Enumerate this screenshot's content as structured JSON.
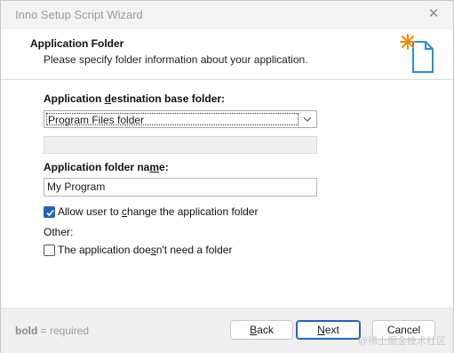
{
  "window": {
    "title": "Inno Setup Script Wizard",
    "close_glyph": "✕"
  },
  "header": {
    "title": "Application Folder",
    "subtitle": "Please specify folder information about your application.",
    "icon": "wizard-page-icon"
  },
  "form": {
    "base_folder_label_pre": "Application ",
    "base_folder_label_u": "d",
    "base_folder_label_post": "estination base folder:",
    "base_folder_value": "Program Files folder",
    "base_folder_custom_value": "",
    "folder_name_label_pre": "Application folder na",
    "folder_name_label_u": "m",
    "folder_name_label_post": "e:",
    "folder_name_value": "My Program",
    "allow_change_pre": "Allow user to ",
    "allow_change_u": "c",
    "allow_change_post": "hange the application folder",
    "allow_change_checked": true,
    "other_label": "Other:",
    "no_folder_pre": "The application doe",
    "no_folder_u": "s",
    "no_folder_post": "n't need a folder",
    "no_folder_checked": false
  },
  "footer": {
    "hint_bold": "bold",
    "hint_rest": " = required",
    "back_pre": "",
    "back_u": "B",
    "back_post": "ack",
    "next_pre": "",
    "next_u": "N",
    "next_post": "ext",
    "cancel_label": "Cancel",
    "watermark": "@稀土掘金技术社区"
  },
  "colors": {
    "accent": "#1f64c5",
    "icon_star": "#f08a00",
    "icon_doc": "#2a8fd6"
  }
}
